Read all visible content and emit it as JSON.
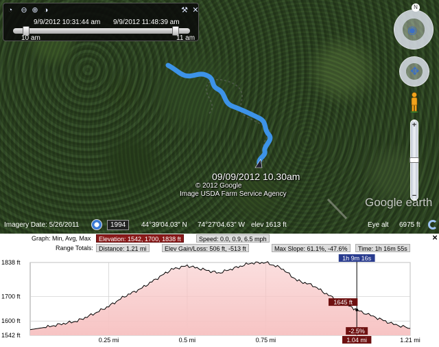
{
  "time_slider": {
    "start_datetime": "9/9/2012   10:31:44 am",
    "end_datetime": "9/9/2012   11:48:39 am",
    "start_hour": "10 am",
    "end_hour": "11 am"
  },
  "map": {
    "track_label": "09/09/2012 10.30am",
    "copyright": "© 2012 Google",
    "imagery_source": "Image USDA Farm Service Agency",
    "logo": "Google earth",
    "track_color": "#3d93e8"
  },
  "nav": {
    "north_label": "N"
  },
  "status_bar": {
    "imagery_date": "Imagery Date: 5/26/2011",
    "imagery_year": "1994",
    "latitude": "44°39'04.03\" N",
    "longitude": "74°27'04.63\" W",
    "elevation": "elev  1613 ft",
    "eye_alt_label": "Eye alt",
    "eye_alt_value": "6975 ft"
  },
  "profile": {
    "graph_label": "Graph:  Min, Avg, Max",
    "elevation_stat": "Elevation: 1542, 1700, 1838 ft",
    "speed_stat": "Speed: 0.0, 0.9, 6.5 mph",
    "range_label": "Range Totals:",
    "distance_stat": "Distance: 1.21 mi",
    "gain_loss_stat": "Elev Gain/Loss: 506 ft, -513 ft",
    "max_slope_stat": "Max Slope: 61.1%, -47.6%",
    "time_stat": "Time: 1h 16m 55s",
    "close_label": "×"
  },
  "chart_data": {
    "type": "area",
    "title": "",
    "xlabel": "",
    "ylabel": "",
    "x_unit": "mi",
    "y_unit": "ft",
    "xlim": [
      0,
      1.21
    ],
    "ylim": [
      1542,
      1838
    ],
    "y_ticks": [
      {
        "value": 1838,
        "label": "1838 ft"
      },
      {
        "value": 1700,
        "label": "1700 ft"
      },
      {
        "value": 1600,
        "label": "1600 ft"
      },
      {
        "value": 1542,
        "label": "1542 ft"
      }
    ],
    "x_ticks": [
      {
        "value": 0.25,
        "label": "0.25 mi"
      },
      {
        "value": 0.5,
        "label": "0.5 mi"
      },
      {
        "value": 0.75,
        "label": "0.75 mi"
      },
      {
        "value": 1.21,
        "label": "1.21 mi"
      }
    ],
    "x": [
      0,
      0.05,
      0.1,
      0.15,
      0.2,
      0.25,
      0.3,
      0.35,
      0.4,
      0.45,
      0.5,
      0.55,
      0.6,
      0.65,
      0.7,
      0.75,
      0.8,
      0.85,
      0.9,
      0.95,
      1.0,
      1.04,
      1.1,
      1.15,
      1.21
    ],
    "y": [
      1565,
      1575,
      1588,
      1600,
      1628,
      1660,
      1700,
      1730,
      1770,
      1810,
      1825,
      1810,
      1795,
      1815,
      1835,
      1838,
      1815,
      1765,
      1745,
      1705,
      1672,
      1645,
      1615,
      1590,
      1570
    ],
    "cursor": {
      "x": 1.04,
      "x_label": "1.04 mi",
      "elevation_label": "1645 ft",
      "slope_label": "-2.5%",
      "time_label": "1h 9m 16s"
    },
    "fill_color": "#f7c4c4",
    "line_color": "#000000",
    "grid": true
  }
}
